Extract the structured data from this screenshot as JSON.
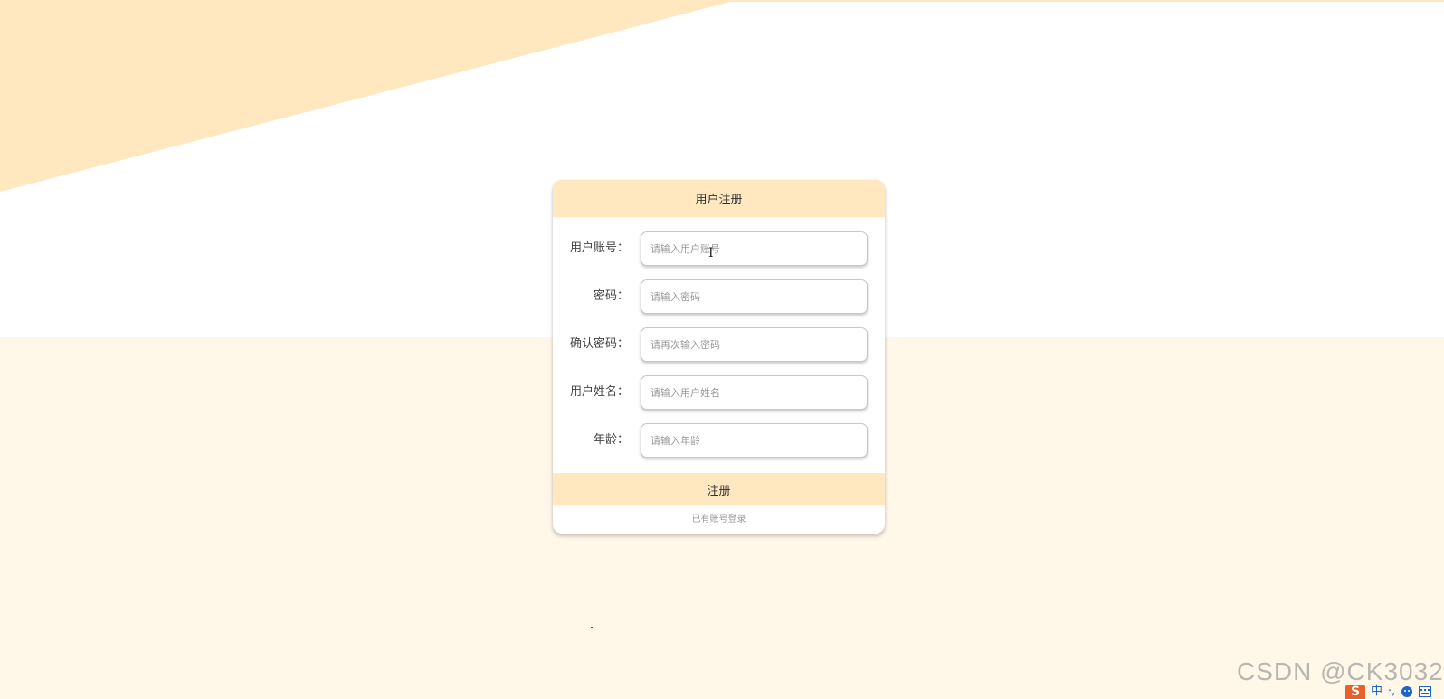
{
  "page": {
    "background_top": "#ffffff",
    "background_bottom": "#fff7e8",
    "accent": "#ffe7bf"
  },
  "register_form": {
    "title": "用户注册",
    "fields": [
      {
        "label": "用户账号：",
        "placeholder": "请输入用户账号",
        "type": "text"
      },
      {
        "label": "密码：",
        "placeholder": "请输入密码",
        "type": "password"
      },
      {
        "label": "确认密码：",
        "placeholder": "请再次输入密码",
        "type": "password"
      },
      {
        "label": "用户姓名：",
        "placeholder": "请输入用户姓名",
        "type": "text"
      },
      {
        "label": "年龄：",
        "placeholder": "请输入年龄",
        "type": "text"
      }
    ],
    "submit_label": "注册",
    "login_link": "已有账号登录"
  },
  "watermark": "CSDN @CK3032",
  "ime": {
    "logo": "S",
    "mode": "中",
    "punct": "·,",
    "emoji_icon": "emoji-icon",
    "keyboard_icon": "keyboard-icon"
  }
}
